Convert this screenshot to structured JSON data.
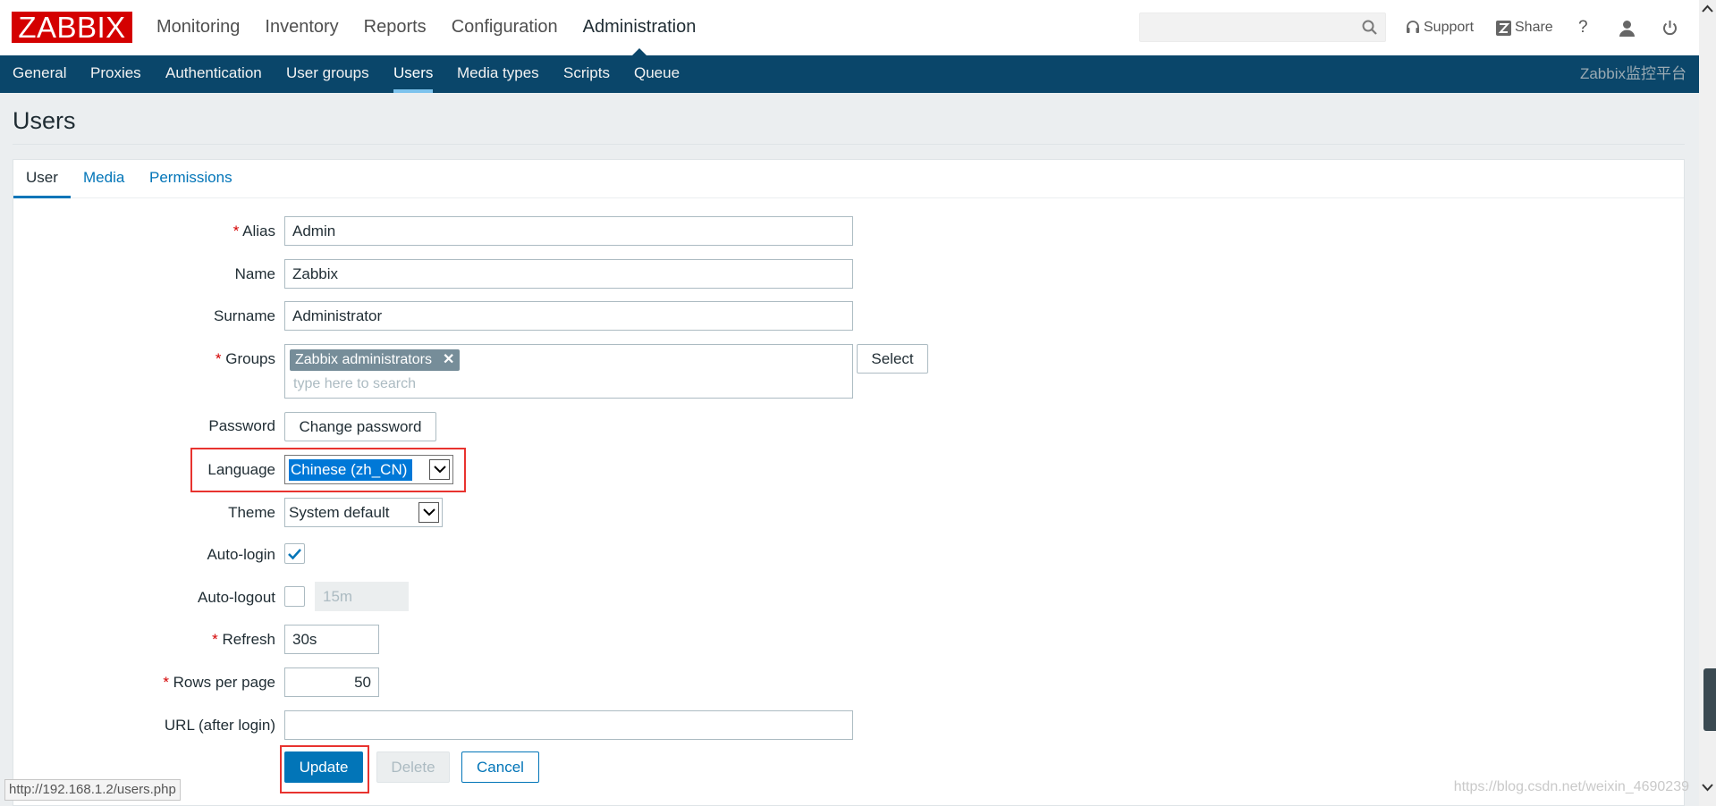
{
  "logo": "ZABBIX",
  "main_nav": [
    "Monitoring",
    "Inventory",
    "Reports",
    "Configuration",
    "Administration"
  ],
  "active_main": "Administration",
  "search": {
    "value": "",
    "placeholder": ""
  },
  "utils": {
    "support": "Support",
    "share": "Share",
    "help": "?"
  },
  "sub_nav": [
    "General",
    "Proxies",
    "Authentication",
    "User groups",
    "Users",
    "Media types",
    "Scripts",
    "Queue"
  ],
  "active_sub": "Users",
  "site_name": "Zabbix监控平台",
  "page_title": "Users",
  "tabs": [
    "User",
    "Media",
    "Permissions"
  ],
  "active_tab": "User",
  "form": {
    "alias_label": "Alias",
    "alias_value": "Admin",
    "name_label": "Name",
    "name_value": "Zabbix",
    "surname_label": "Surname",
    "surname_value": "Administrator",
    "groups_label": "Groups",
    "group_chip": "Zabbix administrators",
    "groups_placeholder": "type here to search",
    "select_button": "Select",
    "password_label": "Password",
    "change_password_button": "Change password",
    "language_label": "Language",
    "language_value": "Chinese (zh_CN)",
    "theme_label": "Theme",
    "theme_value": "System default",
    "autologin_label": "Auto-login",
    "autologin_checked": true,
    "autologout_label": "Auto-logout",
    "autologout_checked": false,
    "autologout_value": "15m",
    "refresh_label": "Refresh",
    "refresh_value": "30s",
    "rows_label": "Rows per page",
    "rows_value": "50",
    "url_label": "URL (after login)",
    "url_value": ""
  },
  "buttons": {
    "update": "Update",
    "delete": "Delete",
    "cancel": "Cancel"
  },
  "status_url": "http://192.168.1.2/users.php",
  "watermark": "https://blog.csdn.net/weixin_4690239",
  "colors": {
    "brand_red": "#d40000",
    "nav_blue": "#0a466a",
    "link_blue": "#0275b8",
    "highlight_red": "#e8332f"
  }
}
